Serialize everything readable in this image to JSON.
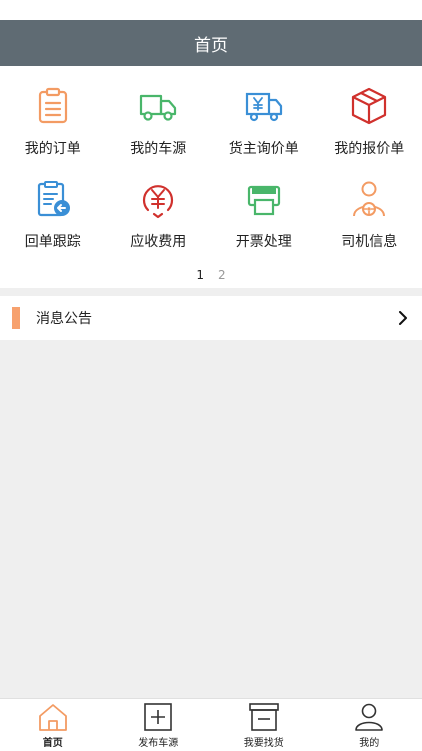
{
  "header": {
    "title": "首页"
  },
  "grid": {
    "items": [
      {
        "label": "我的订单",
        "icon": "clipboard-list-icon"
      },
      {
        "label": "我的车源",
        "icon": "truck-icon"
      },
      {
        "label": "货主询价单",
        "icon": "yuan-truck-icon"
      },
      {
        "label": "我的报价单",
        "icon": "package-box-icon"
      },
      {
        "label": "回单跟踪",
        "icon": "receipt-return-icon"
      },
      {
        "label": "应收费用",
        "icon": "yuan-coin-icon"
      },
      {
        "label": "开票处理",
        "icon": "printer-icon"
      },
      {
        "label": "司机信息",
        "icon": "driver-icon"
      }
    ]
  },
  "pager": {
    "pages": [
      "1",
      "2"
    ],
    "current": "1"
  },
  "notice": {
    "title": "消息公告",
    "accent": "#f7a16e"
  },
  "tabbar": {
    "items": [
      {
        "label": "首页",
        "icon": "home-icon",
        "active": true
      },
      {
        "label": "发布车源",
        "icon": "plus-square-icon"
      },
      {
        "label": "我要找货",
        "icon": "box-search-icon"
      },
      {
        "label": "我的",
        "icon": "user-icon"
      }
    ]
  },
  "colors": {
    "header_bg": "#5f6b73",
    "orange": "#f39b63",
    "green": "#49b66a",
    "blue": "#3a8fd6",
    "red": "#d0312d"
  }
}
